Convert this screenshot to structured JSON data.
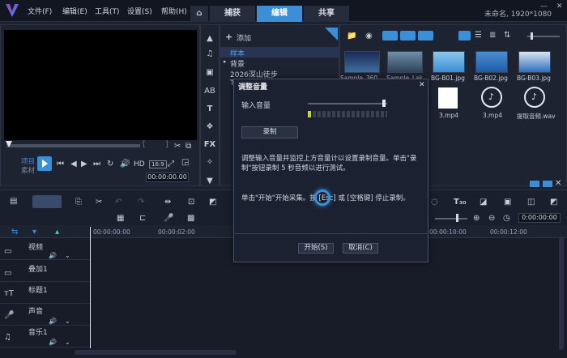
{
  "menu": {
    "file": "文件(F)",
    "edit": "编辑(E)",
    "tools": "工具(T)",
    "settings": "设置(S)",
    "help": "帮助(H)"
  },
  "tabs": {
    "capture": "捕获",
    "edit": "编辑",
    "share": "共享"
  },
  "project_info": "未命名, 1920*1080",
  "library": {
    "add_label": "添加",
    "items": [
      "样本",
      "背景",
      "2026深山徒步",
      "T"
    ],
    "selected": "样本"
  },
  "thumbnails": [
    {
      "label": "Sample_360...",
      "color": "#2a4a78"
    },
    {
      "label": "Sample_Lak...",
      "color": "#4e6f8a"
    },
    {
      "label": "BG-B01.jpg",
      "color": "#5aa6d6"
    },
    {
      "label": "BG-B02.jpg",
      "color": "#3f7fc4"
    },
    {
      "label": "BG-B03.jpg",
      "color": "#2b6bb8"
    }
  ],
  "thumbnails_row2": [
    "3.mp4",
    "3.mp4",
    "提取音频.wav"
  ],
  "player": {
    "project_label": "项目",
    "clip_label": "素材",
    "hd": "HD",
    "aspect": "16:9",
    "timecode": "00:00:00.00"
  },
  "dialog": {
    "title": "调整音量",
    "input_label": "输入音量",
    "record_button": "录制",
    "text1": "调整输入音量并监控上方音量计以设置录制音量。单击\"录制\"按钮录制 5 秒音频以进行测试。",
    "text2": "单击\"开始\"开始采集。按 [Esc] 或 [空格键] 停止录制。",
    "start_button": "开始(S)",
    "cancel_button": "取消(C)"
  },
  "timeline": {
    "ruler": [
      "00:00:00:00",
      "00:00:02:00",
      "00:00:10:00",
      "00:00:12:00"
    ],
    "timecode": "0:00:00:00",
    "tracks": [
      {
        "name": "视频",
        "icon": "video-track-icon"
      },
      {
        "name": "叠加1",
        "icon": "overlay-track-icon"
      },
      {
        "name": "标题1",
        "icon": "title-track-icon"
      },
      {
        "name": "声音",
        "icon": "voice-track-icon"
      },
      {
        "name": "音乐1",
        "icon": "music-track-icon"
      }
    ]
  },
  "colors": {
    "accent": "#3a8fd6",
    "bg": "#1c2130",
    "menubar": "#121620"
  }
}
